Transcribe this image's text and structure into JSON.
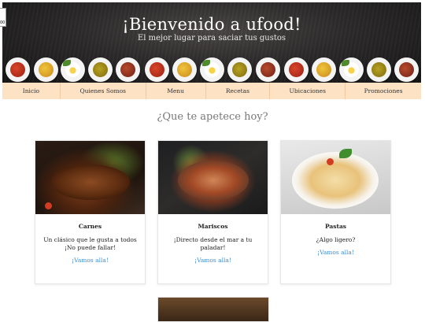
{
  "hero": {
    "title": "¡Bienvenido a ufood!",
    "subtitle": "El mejor lugar para saciar tus gustos"
  },
  "corner_widget": {
    "label": "00"
  },
  "plates": [
    "tomato-soup",
    "curry",
    "egg-dish",
    "lentil-soup",
    "stew",
    "tomato-soup",
    "curry",
    "egg-dish",
    "lentil-soup",
    "stew",
    "tomato-soup",
    "curry",
    "egg-dish",
    "lentil-soup",
    "stew"
  ],
  "nav": {
    "items": [
      {
        "label": "Inicio"
      },
      {
        "label": "Quienes Somos"
      },
      {
        "label": "Menu"
      },
      {
        "label": "Recetas"
      },
      {
        "label": "Ubicaciones"
      },
      {
        "label": "Promociones"
      }
    ]
  },
  "section": {
    "title": "¿Que te apetece hoy?"
  },
  "cards": [
    {
      "name": "Carnes",
      "description": "Un clásico que le gusta a todos ¡No puede fallar!",
      "link": "¡Vamos alla!"
    },
    {
      "name": "Mariscos",
      "description": "¡Directo desde el mar a tu paladar!",
      "link": "¡Vamos alla!"
    },
    {
      "name": "Pastas",
      "description": "¿Algo ligero?",
      "link": "¡Vamos alla!"
    }
  ],
  "colors": {
    "nav_bg": "#fde2c4",
    "link": "#3a8fd6",
    "hero_bg": "#2c2a2a"
  }
}
